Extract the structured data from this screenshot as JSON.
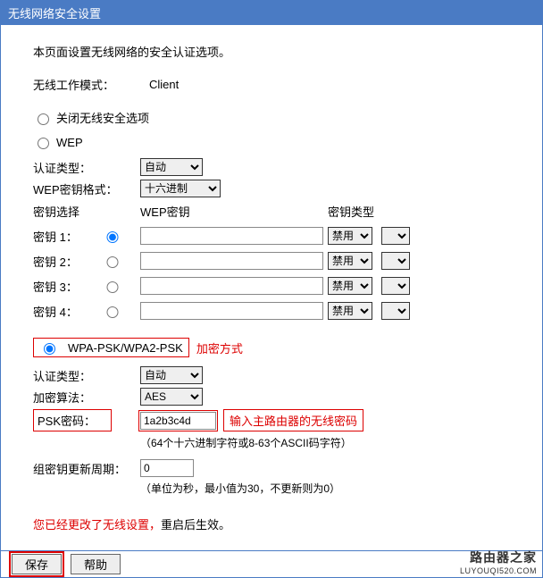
{
  "header": {
    "title": "无线网络安全设置"
  },
  "intro": "本页面设置无线网络的安全认证选项。",
  "wireless_mode": {
    "label": "无线工作模式：",
    "value": "Client"
  },
  "security_off": {
    "label": "关闭无线安全选项"
  },
  "wep": {
    "label": "WEP",
    "auth_type": {
      "label": "认证类型：",
      "value": "自动"
    },
    "key_format": {
      "label": "WEP密钥格式：",
      "value": "十六进制"
    },
    "headers": {
      "select": "密钥选择",
      "key": "WEP密钥",
      "type": "密钥类型"
    },
    "rows": [
      {
        "label": "密钥 1：",
        "value": "",
        "type": "禁用"
      },
      {
        "label": "密钥 2：",
        "value": "",
        "type": "禁用"
      },
      {
        "label": "密钥 3：",
        "value": "",
        "type": "禁用"
      },
      {
        "label": "密钥 4：",
        "value": "",
        "type": "禁用"
      }
    ]
  },
  "wpa": {
    "label": "WPA-PSK/WPA2-PSK",
    "anno_mode": "加密方式",
    "auth_type": {
      "label": "认证类型：",
      "value": "自动"
    },
    "algo": {
      "label": "加密算法：",
      "value": "AES"
    },
    "psk": {
      "label": "PSK密码：",
      "value": "1a2b3c4d",
      "anno": "输入主路由器的无线密码"
    },
    "psk_hint": "（64个十六进制字符或8-63个ASCII码字符）",
    "group_key": {
      "label": "组密钥更新周期：",
      "value": "0",
      "hint": "（单位为秒，最小值为30，不更新则为0）"
    }
  },
  "warning": {
    "part1": "您已经更改了无线设置，",
    "part2": "重启后生效。"
  },
  "footer": {
    "save": "保存",
    "help": "帮助"
  },
  "watermark": {
    "big": "路由器之家",
    "small": "LUYOUQI520.COM"
  }
}
